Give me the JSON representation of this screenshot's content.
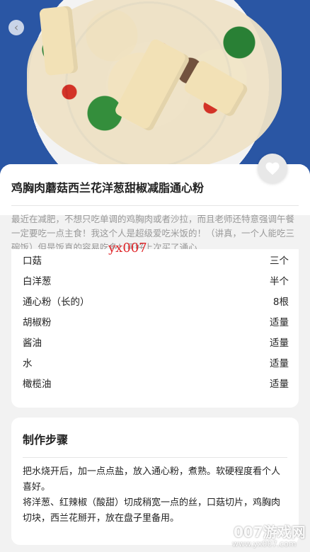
{
  "recipe": {
    "title": "鸡胸肉蘑菇西兰花洋葱甜椒减脂通心粉",
    "description": "最近在减肥，不想只吃单调的鸡胸肉或者沙拉，而且老师还特意强调午餐一定要吃一点主食！我这个人是超级爱吃米饭的！（讲真，一个人能吃三碗饭）但是饭真的容易吃多！正好上次买了通心..."
  },
  "watermark_user": "yx007",
  "ingredients": [
    {
      "name": "口菇",
      "amount": "三个"
    },
    {
      "name": "白洋葱",
      "amount": "半个"
    },
    {
      "name": "通心粉（长的）",
      "amount": "8根"
    },
    {
      "name": "胡椒粉",
      "amount": "适量"
    },
    {
      "name": "酱油",
      "amount": "适量"
    },
    {
      "name": "水",
      "amount": "适量"
    },
    {
      "name": "橄榄油",
      "amount": "适量"
    }
  ],
  "steps": {
    "title": "制作步骤",
    "paragraphs": [
      "把水烧开后，加一点点盐，放入通心粉，煮熟。软硬程度看个人喜好。",
      "将洋葱、红辣椒（酸甜）切成稍宽一点的丝，口菇切片，鸡胸肉切块，西兰花掰开，放在盘子里备用。"
    ]
  },
  "site_watermark": {
    "big": "007游戏网",
    "small": "www.yx007.com"
  },
  "icons": {
    "back": "chevron-left-icon",
    "like": "heart-icon"
  }
}
